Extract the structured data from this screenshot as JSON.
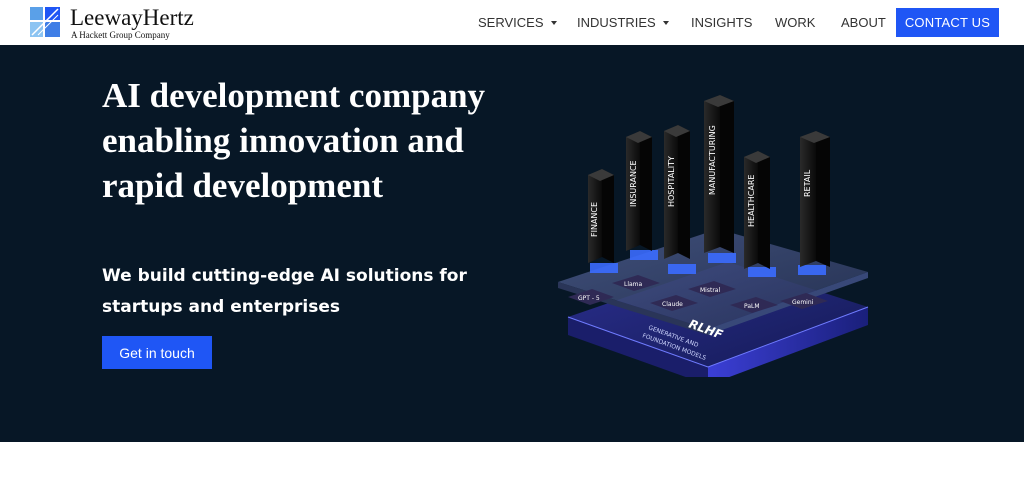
{
  "brand": {
    "name": "LeewayHertz",
    "tagline": "A Hackett Group Company"
  },
  "nav": {
    "items": [
      {
        "label": "SERVICES",
        "dropdown": true
      },
      {
        "label": "INDUSTRIES",
        "dropdown": true
      },
      {
        "label": "INSIGHTS",
        "dropdown": false
      },
      {
        "label": "WORK",
        "dropdown": false
      },
      {
        "label": "ABOUT",
        "dropdown": false
      }
    ],
    "contact_label": "CONTACT US"
  },
  "hero": {
    "title": "AI development company enabling innovation and rapid development",
    "subtitle": "We build cutting-edge AI solutions for startups and enterprises",
    "cta_label": "Get in touch"
  },
  "illustration": {
    "towers": [
      "FINANCE",
      "INSURANCE",
      "HOSPITALITY",
      "MANUFACTURING",
      "HEALTHCARE",
      "RETAIL"
    ],
    "chips": [
      "GPT - 5",
      "Llama",
      "Claude",
      "Mistral",
      "PaLM",
      "Gemini"
    ],
    "base_label": "RLHF",
    "base_caption_1": "GENERATIVE AND",
    "base_caption_2": "FOUNDATION MODELS"
  },
  "colors": {
    "accent": "#1f56f5",
    "hero_bg": "#071726"
  }
}
